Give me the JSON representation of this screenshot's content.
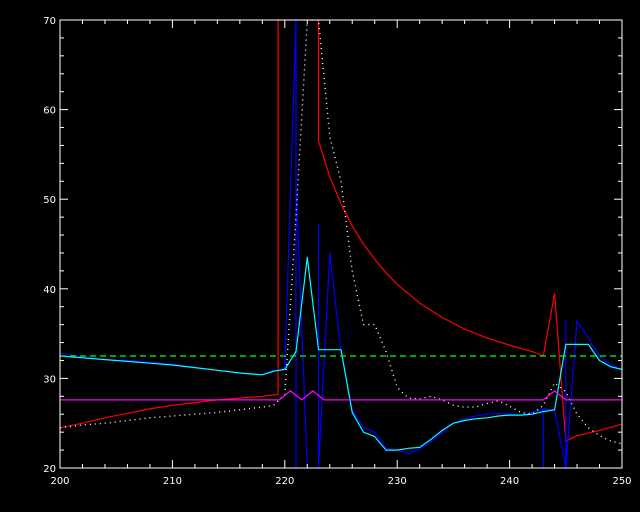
{
  "chart_data": {
    "type": "line",
    "title": "",
    "xlabel": "",
    "ylabel": "",
    "xlim": [
      200,
      250
    ],
    "ylim": [
      20,
      70
    ],
    "x_ticks": [
      200,
      210,
      220,
      230,
      240,
      250
    ],
    "y_ticks": [
      20,
      30,
      40,
      50,
      60,
      70
    ],
    "grid": false,
    "background": "#000000",
    "axis_color": "#ffffff",
    "series": [
      {
        "color": "#ff0000",
        "style": "solid",
        "x": [
          200,
          202,
          204,
          206,
          208,
          210,
          212,
          214,
          216,
          218,
          219.4,
          219.4,
          223.0,
          223.0,
          224,
          225,
          226,
          227,
          228,
          229,
          230,
          232,
          234,
          236,
          238,
          240,
          242,
          243,
          244,
          245,
          246,
          248,
          250
        ],
        "y": [
          24.5,
          25.0,
          25.6,
          26.1,
          26.6,
          27.0,
          27.3,
          27.6,
          27.8,
          28.0,
          28.2,
          70,
          70,
          56.5,
          52.5,
          49.5,
          47.0,
          45.0,
          43.3,
          41.8,
          40.5,
          38.4,
          36.8,
          35.5,
          34.5,
          33.7,
          33.0,
          32.5,
          39.5,
          23.0,
          23.6,
          24.2,
          24.9
        ]
      },
      {
        "color": "#0000ff",
        "style": "solid",
        "x": [
          200,
          202,
          204,
          206,
          208,
          210,
          212,
          214,
          216,
          218,
          219,
          220,
          221,
          221,
          221,
          222,
          222.7,
          223,
          223,
          223,
          224,
          225,
          226,
          227,
          228,
          229,
          230,
          231,
          232,
          233,
          234,
          235,
          236,
          237,
          238,
          239,
          240,
          241,
          242,
          243,
          243,
          243,
          244,
          245,
          245,
          245,
          246,
          247,
          248,
          249,
          250
        ],
        "y": [
          32.8,
          32.4,
          32.1,
          32.0,
          31.8,
          31.6,
          31.2,
          30.9,
          30.6,
          30.4,
          30.9,
          31.0,
          70,
          20,
          52.0,
          20,
          20,
          20,
          47.2,
          20,
          44.0,
          33.0,
          26.5,
          24.5,
          24.0,
          22.2,
          22.0,
          21.6,
          22.1,
          23.0,
          24.0,
          25.0,
          25.5,
          25.8,
          26.0,
          26.1,
          26.0,
          25.9,
          26.2,
          26.6,
          20,
          26.6,
          26.5,
          20,
          36.5,
          20,
          36.4,
          34.5,
          32.5,
          31.5,
          31.0
        ]
      },
      {
        "color": "#00ffff",
        "style": "solid",
        "x": [
          200,
          202,
          204,
          206,
          208,
          210,
          212,
          214,
          216,
          218,
          219,
          220,
          221,
          222,
          223,
          224,
          225,
          226,
          227,
          228,
          229,
          230,
          231,
          232,
          233,
          234,
          235,
          236,
          237,
          238,
          239,
          240,
          241,
          242,
          243,
          244,
          245,
          246,
          247,
          248,
          249,
          250
        ],
        "y": [
          32.5,
          32.3,
          32.1,
          31.9,
          31.7,
          31.5,
          31.2,
          30.9,
          30.6,
          30.4,
          30.8,
          31.0,
          33.0,
          43.5,
          33.2,
          33.2,
          33.2,
          26.2,
          24.0,
          23.5,
          22.0,
          22.0,
          22.2,
          22.3,
          23.2,
          24.2,
          25.0,
          25.3,
          25.5,
          25.6,
          25.8,
          25.9,
          25.9,
          26.0,
          26.3,
          26.5,
          33.8,
          33.8,
          33.8,
          32.0,
          31.3,
          31.0
        ]
      },
      {
        "color": "#ffffff",
        "style": "dotted",
        "x": [
          200,
          202,
          204,
          206,
          208,
          210,
          212,
          214,
          216,
          218,
          219,
          220,
          221,
          222,
          223,
          224,
          225,
          226,
          227,
          228,
          229,
          230,
          231,
          232,
          233,
          234,
          235,
          236,
          237,
          238,
          239,
          240,
          241,
          242,
          243,
          244,
          245,
          246,
          247,
          248,
          249,
          250
        ],
        "y": [
          24.5,
          24.8,
          25.0,
          25.3,
          25.6,
          25.8,
          26.0,
          26.2,
          26.5,
          26.8,
          27.0,
          28.2,
          48.0,
          70,
          70,
          57.0,
          52.0,
          42.0,
          36.0,
          36.0,
          33.0,
          29.0,
          27.8,
          27.7,
          28.0,
          27.6,
          27.0,
          26.8,
          26.8,
          27.2,
          27.5,
          26.9,
          26.2,
          26.0,
          27.0,
          29.5,
          28.5,
          26.0,
          24.5,
          23.6,
          23.0,
          22.7
        ]
      },
      {
        "color": "#ff00ff",
        "style": "solid",
        "x": [
          200,
          219.5,
          220.5,
          221.5,
          222.5,
          223.5,
          243,
          244,
          245,
          250
        ],
        "y": [
          27.6,
          27.6,
          28.6,
          27.6,
          28.6,
          27.6,
          27.6,
          28.6,
          27.6,
          27.6
        ]
      },
      {
        "color": "#00ff00",
        "style": "dashed",
        "x": [
          200,
          250
        ],
        "y": [
          32.5,
          32.5
        ]
      }
    ]
  }
}
